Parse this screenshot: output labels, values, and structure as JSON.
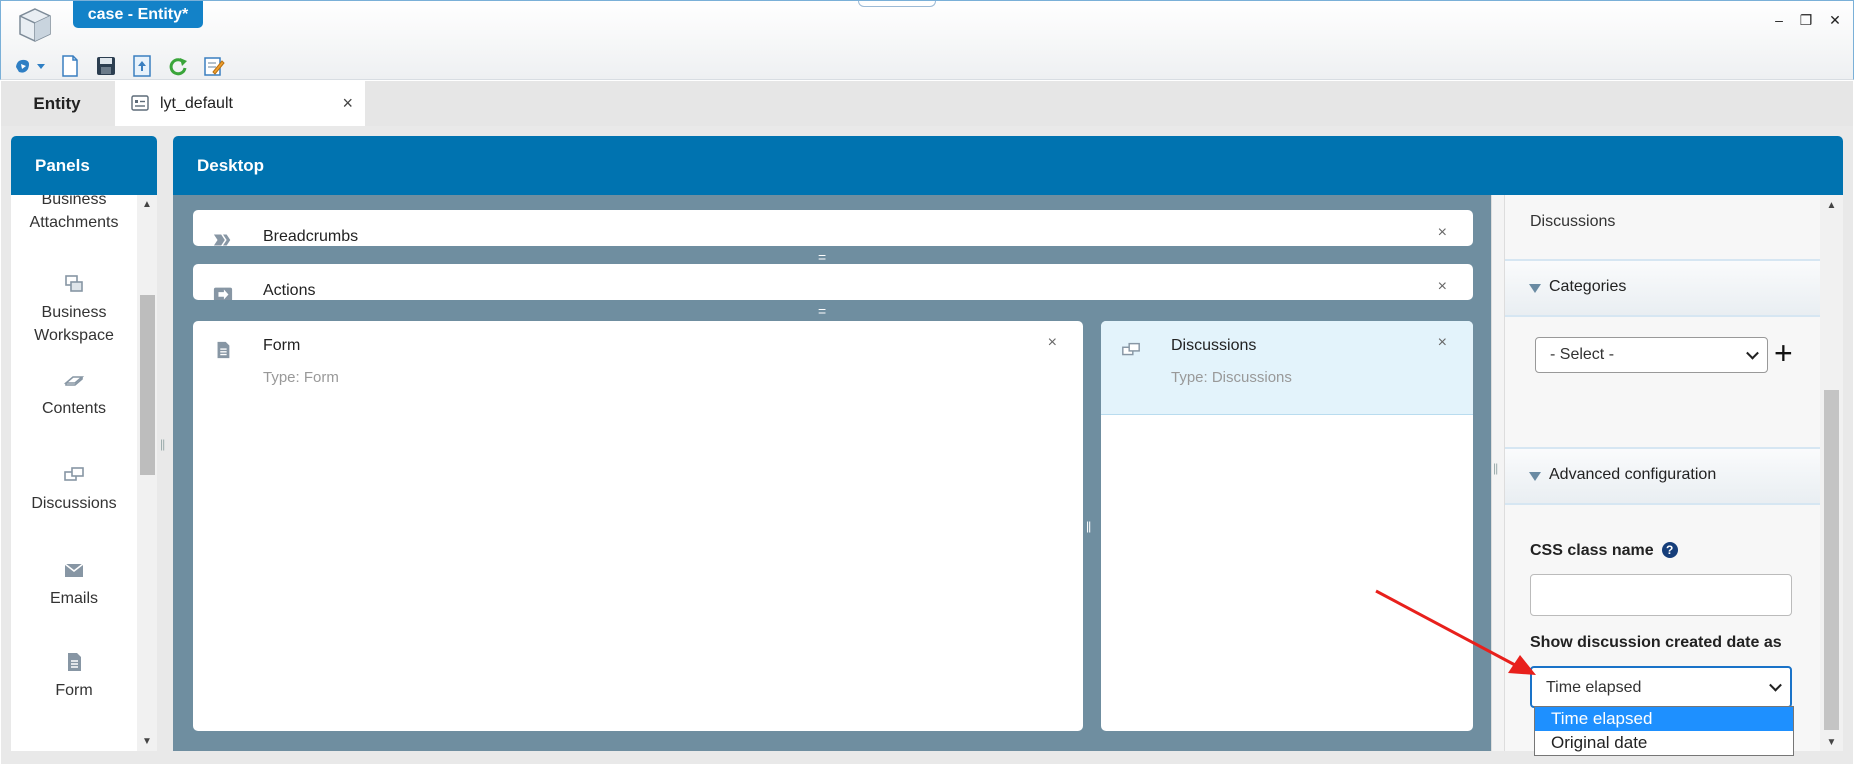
{
  "window": {
    "title": "case - Entity*",
    "controls": {
      "minimize": "–",
      "restore": "❐",
      "close": "✕"
    }
  },
  "toolbar": {
    "items": [
      "process-icon",
      "new-document-icon",
      "save-icon",
      "publish-icon",
      "refresh-icon",
      "edit-icon"
    ]
  },
  "doc_tabs": {
    "entity": "Entity",
    "layout": "lyt_default",
    "close": "×"
  },
  "panels": {
    "title": "Panels",
    "items": [
      {
        "label": "Business Attachments",
        "icon": "attachment-icon"
      },
      {
        "label": "Business Workspace",
        "icon": "workspace-icon"
      },
      {
        "label": "Contents",
        "icon": "contents-icon"
      },
      {
        "label": "Discussions",
        "icon": "discussions-icon"
      },
      {
        "label": "Emails",
        "icon": "email-icon"
      },
      {
        "label": "Form",
        "icon": "form-icon"
      }
    ]
  },
  "desktop": {
    "title": "Desktop",
    "cards": {
      "breadcrumbs": {
        "name": "Breadcrumbs",
        "close": "×"
      },
      "actions": {
        "name": "Actions",
        "close": "×"
      },
      "form": {
        "name": "Form",
        "type": "Type: Form",
        "close": "×"
      },
      "discussions": {
        "name": "Discussions",
        "type": "Type: Discussions",
        "close": "×"
      }
    }
  },
  "properties": {
    "selected_name": "Discussions",
    "categories": {
      "title": "Categories",
      "select_value": "- Select -",
      "add": "+"
    },
    "advanced": {
      "title": "Advanced configuration",
      "css_label": "CSS class name",
      "css_help": "?",
      "css_value": "",
      "date_label": "Show discussion created date as",
      "date_value": "Time elapsed",
      "date_options": [
        "Time elapsed",
        "Original date"
      ]
    }
  },
  "colors": {
    "header_blue": "#0073b0",
    "title_tab_blue": "#1382c8",
    "canvas_slate": "#6f8ea0",
    "selected_card": "#e3f3fb",
    "dropdown_highlight": "#1e90ff",
    "annotation_arrow": "#e8201c"
  }
}
